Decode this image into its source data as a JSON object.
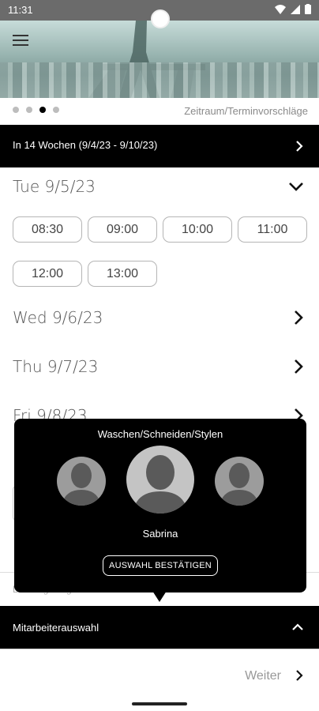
{
  "status_bar": {
    "time": "11:31"
  },
  "header": {
    "pager_dots": 4,
    "active_dot": 3,
    "section_caption": "Zeitraum/Terminvorschläge"
  },
  "range": {
    "label": "In 14 Wochen  (9/4/23 - 9/10/23)"
  },
  "days": [
    {
      "label": "Tue 9/5/23",
      "expanded": true,
      "slots": [
        "08:30",
        "09:00",
        "10:00",
        "11:00",
        "12:00",
        "13:00"
      ]
    },
    {
      "label": "Wed 9/6/23",
      "expanded": false
    },
    {
      "label": "Thu 9/7/23",
      "expanded": false
    },
    {
      "label": "Fri 9/8/23",
      "expanded": false
    }
  ],
  "popup": {
    "title": "Waschen/Schneiden/Stylen",
    "selected_name": "Sabrina",
    "confirm_label": "AUSWAHL BESTÄTIGEN"
  },
  "selection_hint": "Leistung ausgewählt",
  "staff_bar": {
    "label": "Mitarbeiterauswahl"
  },
  "footer": {
    "next_label": "Weiter"
  },
  "colors": {
    "accent": "#000000",
    "status_bar": "#6b6b6b",
    "slot_border": "#b5b5b5"
  }
}
